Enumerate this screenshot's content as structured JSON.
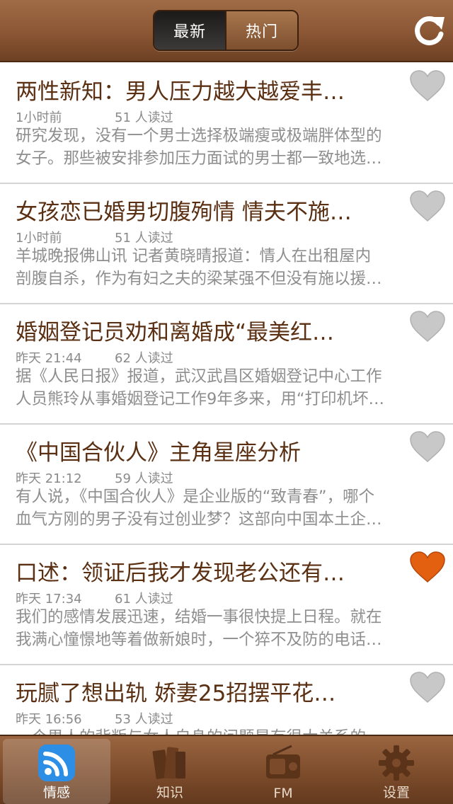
{
  "header": {
    "seg_latest": "最新",
    "seg_hot": "热门"
  },
  "articles": [
    {
      "title": "两性新知：男人压力越大越爱丰…",
      "time": "1小时前",
      "reads": "51 人读过",
      "line1": "研究发现，没有一个男士选择极端瘦或极端胖体型的",
      "line2": "女子。那些被安排参加压力面试的男士都一致地选…",
      "favorited": false
    },
    {
      "title": "女孩恋已婚男切腹殉情 情夫不施…",
      "time": "1小时前",
      "reads": "51 人读过",
      "line1": "羊城晚报佛山讯 记者黄晓晴报道：情人在出租屋内",
      "line2": "剖腹自杀，作为有妇之夫的梁某强不但没有施以援…",
      "favorited": false
    },
    {
      "title": "婚姻登记员劝和离婚成“最美红…",
      "time": "昨天 21:44",
      "reads": "62 人读过",
      "line1": "据《人民日报》报道，武汉武昌区婚姻登记中心工作",
      "line2": "人员熊玲从事婚姻登记工作9年多来，用“打印机坏…",
      "favorited": false
    },
    {
      "title": "《中国合伙人》主角星座分析",
      "time": "昨天 21:12",
      "reads": "59 人读过",
      "line1": "有人说，《中国合伙人》是企业版的“致青春”，哪个",
      "line2": "血气方刚的男子没有过创业梦？这部向中国本土企…",
      "favorited": false
    },
    {
      "title": "口述：领证后我才发现老公还有…",
      "time": "昨天 17:34",
      "reads": "61 人读过",
      "line1": "我们的感情发展迅速，结婚一事很快提上日程。就在",
      "line2": "我满心憧憬地等着做新娘时，一个猝不及防的电话…",
      "favorited": true
    },
    {
      "title": "玩腻了想出轨 娇妻25招摆平花…",
      "time": "昨天 16:56",
      "reads": "53 人读过",
      "line1": "一个男人的背叛与女人自身的问题是有很大关系的",
      "line2": "",
      "favorited": false
    }
  ],
  "tabbar": {
    "tabs": [
      {
        "label": "情感",
        "icon": "rss-icon",
        "active": true
      },
      {
        "label": "知识",
        "icon": "books-icon",
        "active": false
      },
      {
        "label": "FM",
        "icon": "radio-icon",
        "active": false
      },
      {
        "label": "设置",
        "icon": "gear-icon",
        "active": false
      }
    ]
  },
  "colors": {
    "brand_brown": "#8a5634",
    "title_text": "#5a2f12",
    "heart_active": "#e2600f",
    "heart_inactive": "#c8c8c8"
  }
}
